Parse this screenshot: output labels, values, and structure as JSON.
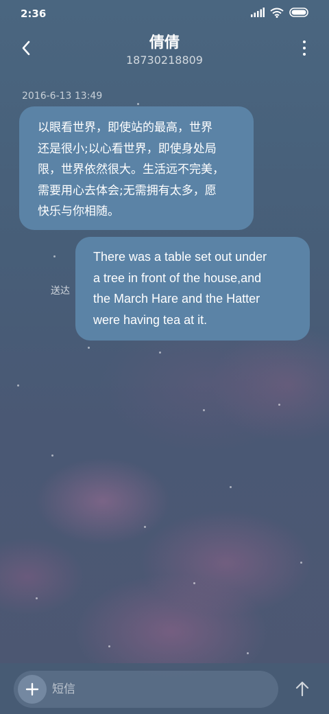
{
  "status_bar": {
    "time": "2:36",
    "icons": [
      "signal-icon",
      "wifi-icon",
      "battery-icon"
    ]
  },
  "header": {
    "contact_name": "倩倩",
    "contact_number": "18730218809",
    "back_icon": "chevron-left-icon",
    "more_icon": "more-vertical-icon"
  },
  "conversation": {
    "timestamp": "2016-6-13 13:49",
    "messages": [
      {
        "direction": "incoming",
        "lines": [
          "以眼看世界，即使站的最高，世界",
          "还是很小;以心看世界，即使身处局",
          "限，世界依然很大。生活远不完美，",
          "需要用心去体会;无需拥有太多，愿",
          "快乐与你相随。"
        ]
      },
      {
        "direction": "outgoing",
        "lines": [
          "There was a table set out under",
          "a tree in front of the house,and",
          "the March Hare and the Hatter",
          "were having tea at it."
        ],
        "status": "送达"
      }
    ]
  },
  "composer": {
    "placeholder": "短信",
    "add_icon": "plus-icon",
    "send_icon": "arrow-up-icon"
  },
  "colors": {
    "bubble": "#5b83a6",
    "background_top": "#4a6680",
    "background_bottom": "#4d5772"
  }
}
